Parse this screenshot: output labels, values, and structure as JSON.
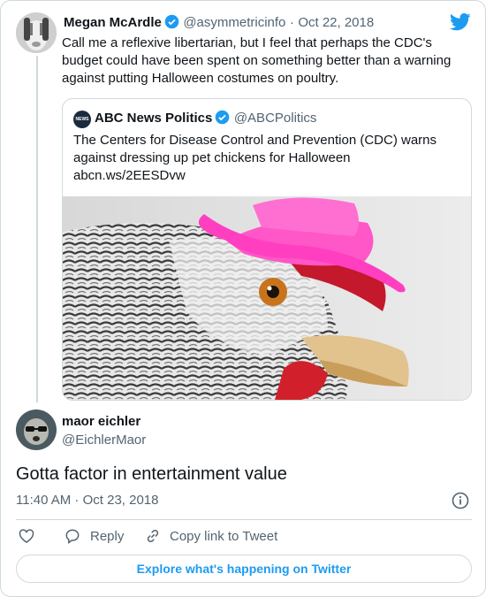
{
  "tweet": {
    "author_name": "Megan McArdle",
    "author_handle": "@asymmetricinfo",
    "date": "Oct 22, 2018",
    "separator": "·",
    "text_lines": [
      "Call me a reflexive libertarian, but I feel that perhaps the CDC's",
      "budget could have been spent on something better than a warning",
      "against putting Halloween costumes on poultry."
    ]
  },
  "quoted": {
    "author_name": "ABC News Politics",
    "author_handle": "@ABCPolitics",
    "text_lines": [
      "The Centers for Disease Control and Prevention (CDC) warns",
      "against dressing up pet chickens for Halloween"
    ],
    "link": "abcn.ws/2EESDvw",
    "logo_text": "NEWS"
  },
  "reply": {
    "author_name": "maor eichler",
    "author_handle": "@EichlerMaor",
    "text": "Gotta factor in entertainment value",
    "timestamp": "11:40 AM · Oct 23, 2018"
  },
  "actions": {
    "reply_label": "Reply",
    "copy_label": "Copy link to Tweet"
  },
  "explore_label": "Explore what's happening on Twitter",
  "icons": [
    "twitter-bird-icon",
    "verified-badge-icon",
    "info-icon",
    "heart-icon",
    "reply-icon",
    "link-icon"
  ],
  "colors": {
    "accent": "#1d9bf0",
    "text": "#0f1419",
    "muted": "#536471",
    "border": "#cfd9de",
    "hat": "#ff4fc4"
  }
}
